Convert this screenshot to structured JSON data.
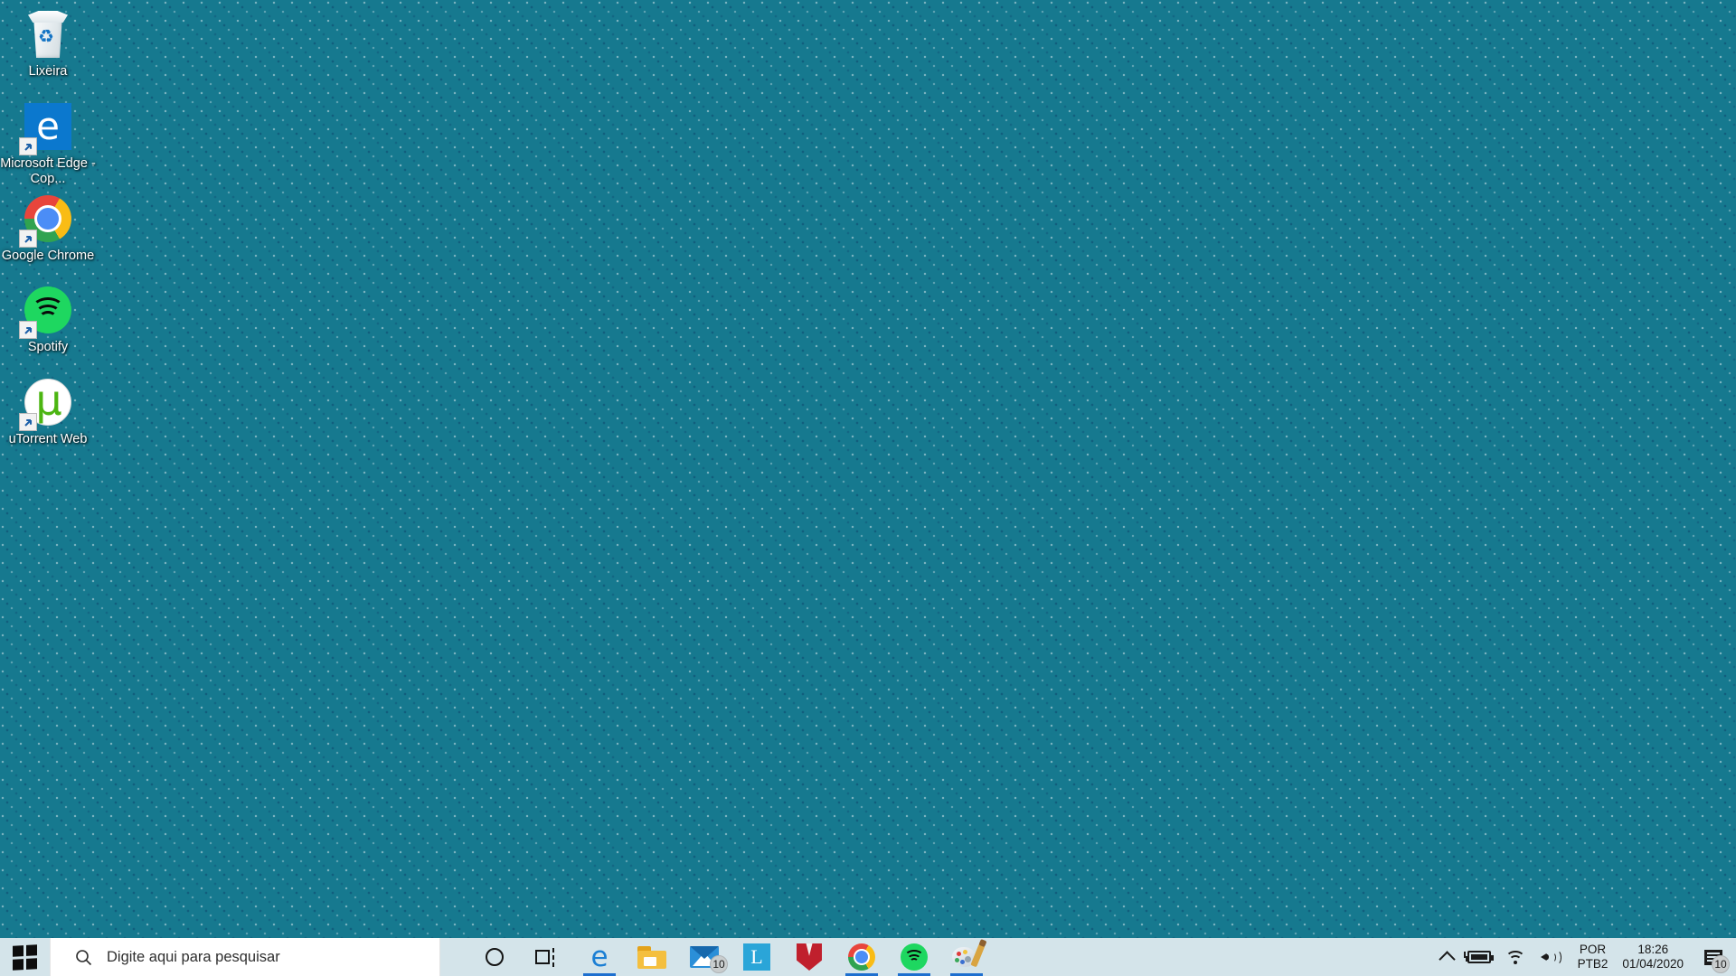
{
  "desktop": {
    "background_color": "#16798f",
    "icons": [
      {
        "name": "recycle-bin",
        "label": "Lixeira",
        "icon": "recycle-bin-icon",
        "shortcut": false
      },
      {
        "name": "microsoft-edge",
        "label": "Microsoft Edge - Cop...",
        "icon": "edge-icon",
        "shortcut": true
      },
      {
        "name": "google-chrome",
        "label": "Google Chrome",
        "icon": "chrome-icon",
        "shortcut": true
      },
      {
        "name": "spotify",
        "label": "Spotify",
        "icon": "spotify-icon",
        "shortcut": true
      },
      {
        "name": "utorrent-web",
        "label": "uTorrent Web",
        "icon": "utorrent-icon",
        "shortcut": true
      }
    ]
  },
  "taskbar": {
    "background_color": "#d4e4ea",
    "start_label": "Iniciar",
    "start_icon": "windows-logo-icon",
    "search": {
      "placeholder": "Digite aqui para pesquisar",
      "value": "",
      "icon": "search-icon"
    },
    "buttons": [
      {
        "name": "cortana",
        "label": "Cortana",
        "icon": "cortana-circle-icon",
        "active": false,
        "badge": ""
      },
      {
        "name": "task-view",
        "label": "Visão de Tarefas",
        "icon": "task-view-icon",
        "active": false,
        "badge": ""
      },
      {
        "name": "edge",
        "label": "Microsoft Edge",
        "icon": "edge-icon",
        "active": true,
        "badge": ""
      },
      {
        "name": "file-explorer",
        "label": "Explorador de Arquivos",
        "icon": "folder-icon",
        "active": false,
        "badge": ""
      },
      {
        "name": "mail",
        "label": "Email",
        "icon": "mail-icon",
        "active": false,
        "badge": "10"
      },
      {
        "name": "l-app",
        "label": "L",
        "icon": "l-app-icon",
        "active": false,
        "badge": ""
      },
      {
        "name": "mcafee",
        "label": "McAfee",
        "icon": "mcafee-shield-icon",
        "active": false,
        "badge": ""
      },
      {
        "name": "chrome",
        "label": "Google Chrome",
        "icon": "chrome-icon",
        "active": true,
        "badge": ""
      },
      {
        "name": "spotify",
        "label": "Spotify",
        "icon": "spotify-icon",
        "active": true,
        "badge": ""
      },
      {
        "name": "paint-3d",
        "label": "Paint 3D",
        "icon": "paint-palette-icon",
        "active": true,
        "badge": ""
      }
    ],
    "tray": {
      "show_hidden_icons": "show-hidden-icons-chevron",
      "battery": "battery-charging-icon",
      "network": "wifi-icon",
      "volume": "volume-icon",
      "language_line1": "POR",
      "language_line2": "PTB2",
      "time": "18:26",
      "date": "01/04/2020",
      "action_center_icon": "action-center-icon",
      "action_center_badge": "10"
    }
  }
}
